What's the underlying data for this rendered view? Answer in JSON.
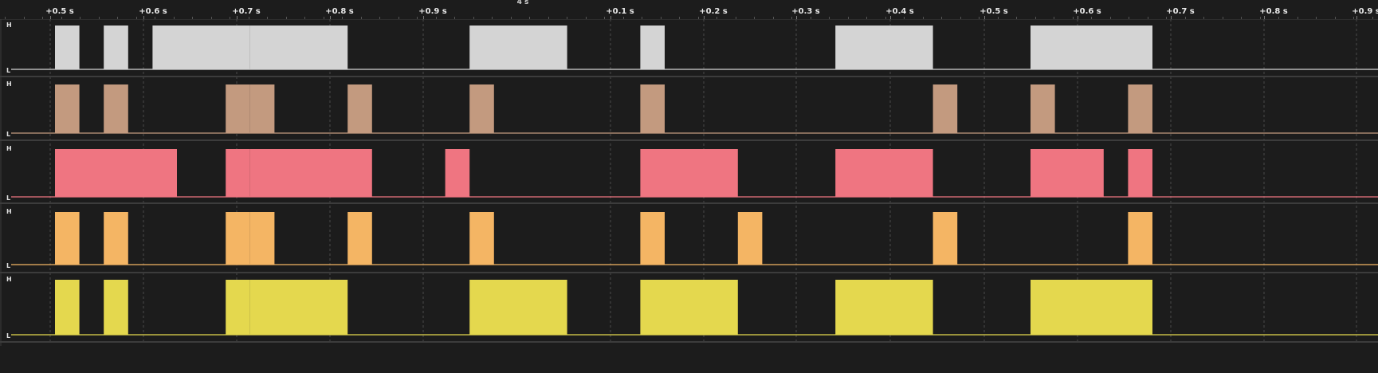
{
  "ruler": {
    "center_label": "4 s",
    "ticks": [
      "+0.5 s",
      "+0.6 s",
      "+0.7 s",
      "+0.8 s",
      "+0.9 s",
      "+0.1 s",
      "+0.2 s",
      "+0.3 s",
      "+0.4 s",
      "+0.5 s",
      "+0.6 s",
      "+0.7 s",
      "+0.8 s",
      "+0.9 s"
    ]
  },
  "level_labels": {
    "high": "H",
    "low": "L"
  },
  "channels": [
    {
      "color": "#d4d4d4",
      "pulses": [
        [
          0,
          1
        ],
        [
          2,
          3
        ],
        [
          4,
          8
        ],
        [
          8,
          12
        ],
        [
          17,
          21
        ],
        [
          24,
          25
        ],
        [
          32,
          36
        ],
        [
          40,
          45
        ]
      ]
    },
    {
      "color": "#c39a7f",
      "pulses": [
        [
          0,
          1
        ],
        [
          2,
          3
        ],
        [
          7,
          8
        ],
        [
          8,
          9
        ],
        [
          12,
          13
        ],
        [
          17,
          18
        ],
        [
          24,
          25
        ],
        [
          36,
          37
        ],
        [
          40,
          41
        ],
        [
          44,
          45
        ]
      ]
    },
    {
      "color": "#ef7581",
      "pulses": [
        [
          0,
          5
        ],
        [
          7,
          8
        ],
        [
          8,
          13
        ],
        [
          16,
          17
        ],
        [
          24,
          28
        ],
        [
          32,
          36
        ],
        [
          40,
          43
        ],
        [
          44,
          45
        ]
      ]
    },
    {
      "color": "#f4b564",
      "pulses": [
        [
          0,
          1
        ],
        [
          2,
          3
        ],
        [
          7,
          8
        ],
        [
          8,
          9
        ],
        [
          12,
          13
        ],
        [
          17,
          18
        ],
        [
          24,
          25
        ],
        [
          28,
          29
        ],
        [
          36,
          37
        ],
        [
          44,
          45
        ]
      ]
    },
    {
      "color": "#e4d84e",
      "pulses": [
        [
          0,
          1
        ],
        [
          2,
          3
        ],
        [
          7,
          8
        ],
        [
          8,
          12
        ],
        [
          17,
          21
        ],
        [
          24,
          28
        ],
        [
          32,
          36
        ],
        [
          40,
          45
        ]
      ]
    }
  ]
}
